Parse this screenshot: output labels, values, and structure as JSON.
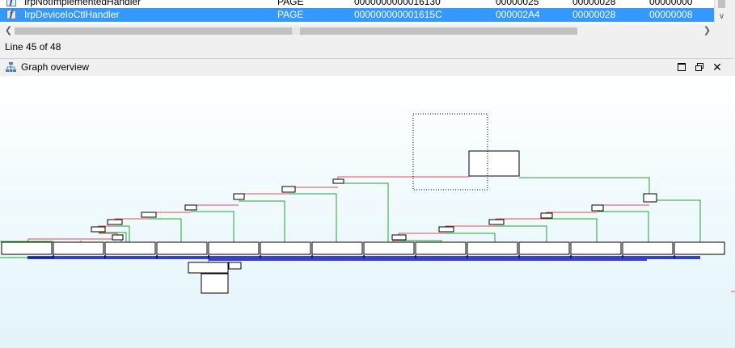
{
  "functions": {
    "rows": [
      {
        "name": "IrpNotImplementedHandler",
        "segment": "PAGE",
        "start": "0000000000016130",
        "length": "00000025",
        "locals": "00000028",
        "arguments": "00000000",
        "selected": false
      },
      {
        "name": "IrpDeviceIoCtlHandler",
        "segment": "PAGE",
        "start": "000000000001615C",
        "length": "000002A4",
        "locals": "00000028",
        "arguments": "00000008",
        "selected": true
      }
    ],
    "function_icon": "function-icon",
    "selection_color": "#3399ff"
  },
  "status": {
    "line": "Line 45 of 48"
  },
  "graph_overview": {
    "title": "Graph overview",
    "title_icon": "graph-tree-icon",
    "buttons": {
      "maximize": "maximize-icon",
      "restore": "restore-icon",
      "close": "close-icon"
    },
    "colors": {
      "true_edge": "#2ca02c",
      "false_edge": "#e05050",
      "normal_edge": "#0000c0",
      "node_fill": "#ffffff",
      "background": "#e3f4fa"
    }
  }
}
